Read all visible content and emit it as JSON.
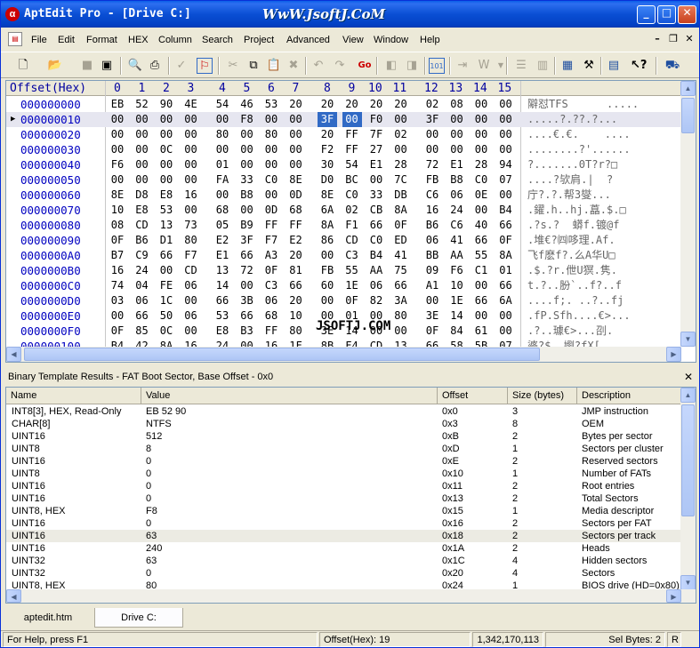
{
  "window": {
    "title": "AptEdit Pro - [Drive C:]",
    "watermark": "WwW.JsoftJ.CoM"
  },
  "menu": [
    "File",
    "Edit",
    "Format",
    "HEX",
    "Column",
    "Search",
    "Project",
    "Advanced",
    "View",
    "Window",
    "Help"
  ],
  "hex": {
    "header_offset": "Offset(Hex)",
    "header_cols": [
      "0",
      "1",
      "2",
      "3",
      "4",
      "5",
      "6",
      "7",
      "8",
      "9",
      "10",
      "11",
      "12",
      "13",
      "14",
      "15"
    ],
    "selected_row": 1,
    "selected_byte": 8,
    "rows": [
      {
        "offset": "000000000",
        "bytes": [
          "EB",
          "52",
          "90",
          "4E",
          "54",
          "46",
          "53",
          "20",
          "20",
          "20",
          "20",
          "20",
          "02",
          "08",
          "00",
          "00"
        ],
        "ascii": "隦怼TFS      ....."
      },
      {
        "offset": "000000010",
        "bytes": [
          "00",
          "00",
          "00",
          "00",
          "00",
          "F8",
          "00",
          "00",
          "3F",
          "00",
          "F0",
          "00",
          "3F",
          "00",
          "00",
          "00"
        ],
        "ascii": ".....?.??.?..."
      },
      {
        "offset": "000000020",
        "bytes": [
          "00",
          "00",
          "00",
          "00",
          "80",
          "00",
          "80",
          "00",
          "20",
          "FF",
          "7F",
          "02",
          "00",
          "00",
          "00",
          "00"
        ],
        "ascii": "....€.€.    ...."
      },
      {
        "offset": "000000030",
        "bytes": [
          "00",
          "00",
          "0C",
          "00",
          "00",
          "00",
          "00",
          "00",
          "F2",
          "FF",
          "27",
          "00",
          "00",
          "00",
          "00",
          "00"
        ],
        "ascii": "........?'......"
      },
      {
        "offset": "000000040",
        "bytes": [
          "F6",
          "00",
          "00",
          "00",
          "01",
          "00",
          "00",
          "00",
          "30",
          "54",
          "E1",
          "28",
          "72",
          "E1",
          "28",
          "94"
        ],
        "ascii": "?.......0T?r?□"
      },
      {
        "offset": "000000050",
        "bytes": [
          "00",
          "00",
          "00",
          "00",
          "FA",
          "33",
          "C0",
          "8E",
          "D0",
          "BC",
          "00",
          "7C",
          "FB",
          "B8",
          "C0",
          "07"
        ],
        "ascii": "....?欤肩.|  ?"
      },
      {
        "offset": "000000060",
        "bytes": [
          "8E",
          "D8",
          "E8",
          "16",
          "00",
          "B8",
          "00",
          "0D",
          "8E",
          "C0",
          "33",
          "DB",
          "C6",
          "06",
          "0E",
          "00"
        ],
        "ascii": "庁?.?.帮3燮..."
      },
      {
        "offset": "000000070",
        "bytes": [
          "10",
          "E8",
          "53",
          "00",
          "68",
          "00",
          "0D",
          "68",
          "6A",
          "02",
          "CB",
          "8A",
          "16",
          "24",
          "00",
          "B4"
        ],
        "ascii": ".鑃.h..hj.藠.$.□"
      },
      {
        "offset": "000000080",
        "bytes": [
          "08",
          "CD",
          "13",
          "73",
          "05",
          "B9",
          "FF",
          "FF",
          "8A",
          "F1",
          "66",
          "0F",
          "B6",
          "C6",
          "40",
          "66"
        ],
        "ascii": ".?s.?  蟒f.镀@f"
      },
      {
        "offset": "000000090",
        "bytes": [
          "0F",
          "B6",
          "D1",
          "80",
          "E2",
          "3F",
          "F7",
          "E2",
          "86",
          "CD",
          "C0",
          "ED",
          "06",
          "41",
          "66",
          "0F"
        ],
        "ascii": ".堆€?㈣哆理.Af."
      },
      {
        "offset": "0000000A0",
        "bytes": [
          "B7",
          "C9",
          "66",
          "F7",
          "E1",
          "66",
          "A3",
          "20",
          "00",
          "C3",
          "B4",
          "41",
          "BB",
          "AA",
          "55",
          "8A"
        ],
        "ascii": "飞f麽f?.么A华U□"
      },
      {
        "offset": "0000000B0",
        "bytes": [
          "16",
          "24",
          "00",
          "CD",
          "13",
          "72",
          "0F",
          "81",
          "FB",
          "55",
          "AA",
          "75",
          "09",
          "F6",
          "C1",
          "01"
        ],
        "ascii": ".$.?r.伳U猽.隽."
      },
      {
        "offset": "0000000C0",
        "bytes": [
          "74",
          "04",
          "FE",
          "06",
          "14",
          "00",
          "C3",
          "66",
          "60",
          "1E",
          "06",
          "66",
          "A1",
          "10",
          "00",
          "66"
        ],
        "ascii": "t.?..肦`..f?..f"
      },
      {
        "offset": "0000000D0",
        "bytes": [
          "03",
          "06",
          "1C",
          "00",
          "66",
          "3B",
          "06",
          "20",
          "00",
          "0F",
          "82",
          "3A",
          "00",
          "1E",
          "66",
          "6A"
        ],
        "ascii": "....f;. ..?..fj"
      },
      {
        "offset": "0000000E0",
        "bytes": [
          "00",
          "66",
          "50",
          "06",
          "53",
          "66",
          "68",
          "10",
          "00",
          "01",
          "00",
          "80",
          "3E",
          "14",
          "00",
          "00"
        ],
        "ascii": ".fP.Sfh....€>..."
      },
      {
        "offset": "0000000F0",
        "bytes": [
          "0F",
          "85",
          "0C",
          "00",
          "E8",
          "B3",
          "FF",
          "80",
          "3E",
          "14",
          "00",
          "00",
          "0F",
          "84",
          "61",
          "00"
        ],
        "ascii": ".?..璩€>...刟."
      },
      {
        "offset": "000000100",
        "bytes": [
          "B4",
          "42",
          "8A",
          "16",
          "24",
          "00",
          "16",
          "1F",
          "8B",
          "F4",
          "CD",
          "13",
          "66",
          "58",
          "5B",
          "07"
        ],
        "ascii": "碆?$..嬼?fX[."
      }
    ]
  },
  "template": {
    "pane_title": "Binary Template Results - FAT Boot Sector, Base Offset - 0x0",
    "columns": [
      "Name",
      "Value",
      "Offset",
      "Size (bytes)",
      "Description"
    ],
    "selected_row": 10,
    "rows": [
      [
        "INT8[3], HEX, Read-Only",
        "EB 52 90",
        "0x0",
        "3",
        "JMP instruction"
      ],
      [
        "CHAR[8]",
        "NTFS",
        "0x3",
        "8",
        "OEM"
      ],
      [
        "UINT16",
        "512",
        "0xB",
        "2",
        "Bytes per sector"
      ],
      [
        "UINT8",
        "8",
        "0xD",
        "1",
        "Sectors per cluster"
      ],
      [
        "UINT16",
        "0",
        "0xE",
        "2",
        "Reserved sectors"
      ],
      [
        "UINT8",
        "0",
        "0x10",
        "1",
        "Number of FATs"
      ],
      [
        "UINT16",
        "0",
        "0x11",
        "2",
        "Root entries"
      ],
      [
        "UINT16",
        "0",
        "0x13",
        "2",
        "Total Sectors"
      ],
      [
        "UINT8, HEX",
        "F8",
        "0x15",
        "1",
        "Media descriptor"
      ],
      [
        "UINT16",
        "0",
        "0x16",
        "2",
        "Sectors per FAT"
      ],
      [
        "UINT16",
        "63",
        "0x18",
        "2",
        "Sectors per track"
      ],
      [
        "UINT16",
        "240",
        "0x1A",
        "2",
        "Heads"
      ],
      [
        "UINT32",
        "63",
        "0x1C",
        "4",
        "Hidden sectors"
      ],
      [
        "UINT32",
        "0",
        "0x20",
        "4",
        "Sectors"
      ],
      [
        "UINT8, HEX",
        "80",
        "0x24",
        "1",
        "BIOS drive (HD=0x80)"
      ]
    ]
  },
  "tabs": [
    "aptedit.htm",
    "Drive C:"
  ],
  "status": {
    "help": "For Help, press F1",
    "offset": "Offset(Hex): 19",
    "size": "1,342,170,113",
    "selbytes": "Sel Bytes: 2",
    "mode": "R"
  },
  "colors": {
    "title_bar": "#0a4fd4",
    "offset_text": "#0000c0",
    "selection": "#316ac5",
    "face": "#ece9d8"
  },
  "hex_watermark": "JSOFTJ.COM"
}
